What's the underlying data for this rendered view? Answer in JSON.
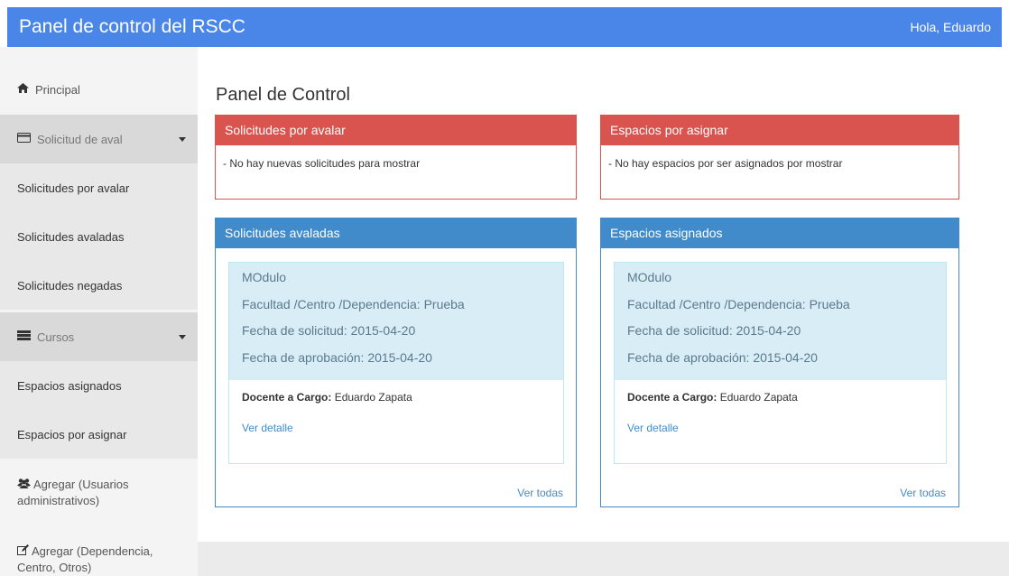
{
  "header": {
    "brand": "Panel de control del RSCC",
    "greeting": "Hola, Eduardo"
  },
  "sidebar": {
    "principal": "Principal",
    "solicitud_toggle": "Solicitud de aval",
    "solicitud_items": [
      "Solicitudes por avalar",
      "Solicitudes avaladas",
      "Solicitudes negadas"
    ],
    "cursos_toggle": "Cursos",
    "cursos_items": [
      "Espacios asignados",
      "Espacios por asignar"
    ],
    "agregar_usuarios": {
      "line1": "Agregar (Usuarios",
      "line2": "administrativos)"
    },
    "agregar_dependencia": {
      "line1": "Agregar (Dependencia,",
      "line2": "Centro, Otros)"
    }
  },
  "main": {
    "title": "Panel de Control",
    "panels": {
      "por_avalar": {
        "heading": "Solicitudes por avalar",
        "body": "- No hay nuevas solicitudes para mostrar"
      },
      "por_asignar": {
        "heading": "Espacios por asignar",
        "body": "- No hay espacios por ser asignados por mostrar"
      },
      "avaladas": {
        "heading": "Solicitudes avaladas",
        "card": {
          "name": "MOdulo",
          "facultad": "Facultad /Centro /Dependencia: Prueba",
          "fecha_solicitud": "Fecha de solicitud: 2015-04-20",
          "fecha_aprobacion": "Fecha de aprobación: 2015-04-20",
          "docente_label": "Docente a Cargo:",
          "docente_value": " Eduardo Zapata",
          "detail_link": "Ver detalle"
        },
        "footer_link": "Ver todas"
      },
      "asignados": {
        "heading": "Espacios asignados",
        "card": {
          "name": "MOdulo",
          "facultad": "Facultad /Centro /Dependencia: Prueba",
          "fecha_solicitud": "Fecha de solicitud: 2015-04-20",
          "fecha_aprobacion": "Fecha de aprobación: 2015-04-20",
          "docente_label": "Docente a Cargo:",
          "docente_value": " Eduardo Zapata",
          "detail_link": "Ver detalle"
        },
        "footer_link": "Ver todas"
      }
    }
  },
  "colors": {
    "brand": "#4a86e8",
    "danger": "#d9534f",
    "primary": "#428bca",
    "info_bg": "#d9edf7"
  },
  "icons": {
    "principal": "home-icon",
    "solicitud": "credit-card-icon",
    "cursos": "list-icon",
    "usuarios": "users-icon",
    "dependencia": "edit-icon"
  }
}
